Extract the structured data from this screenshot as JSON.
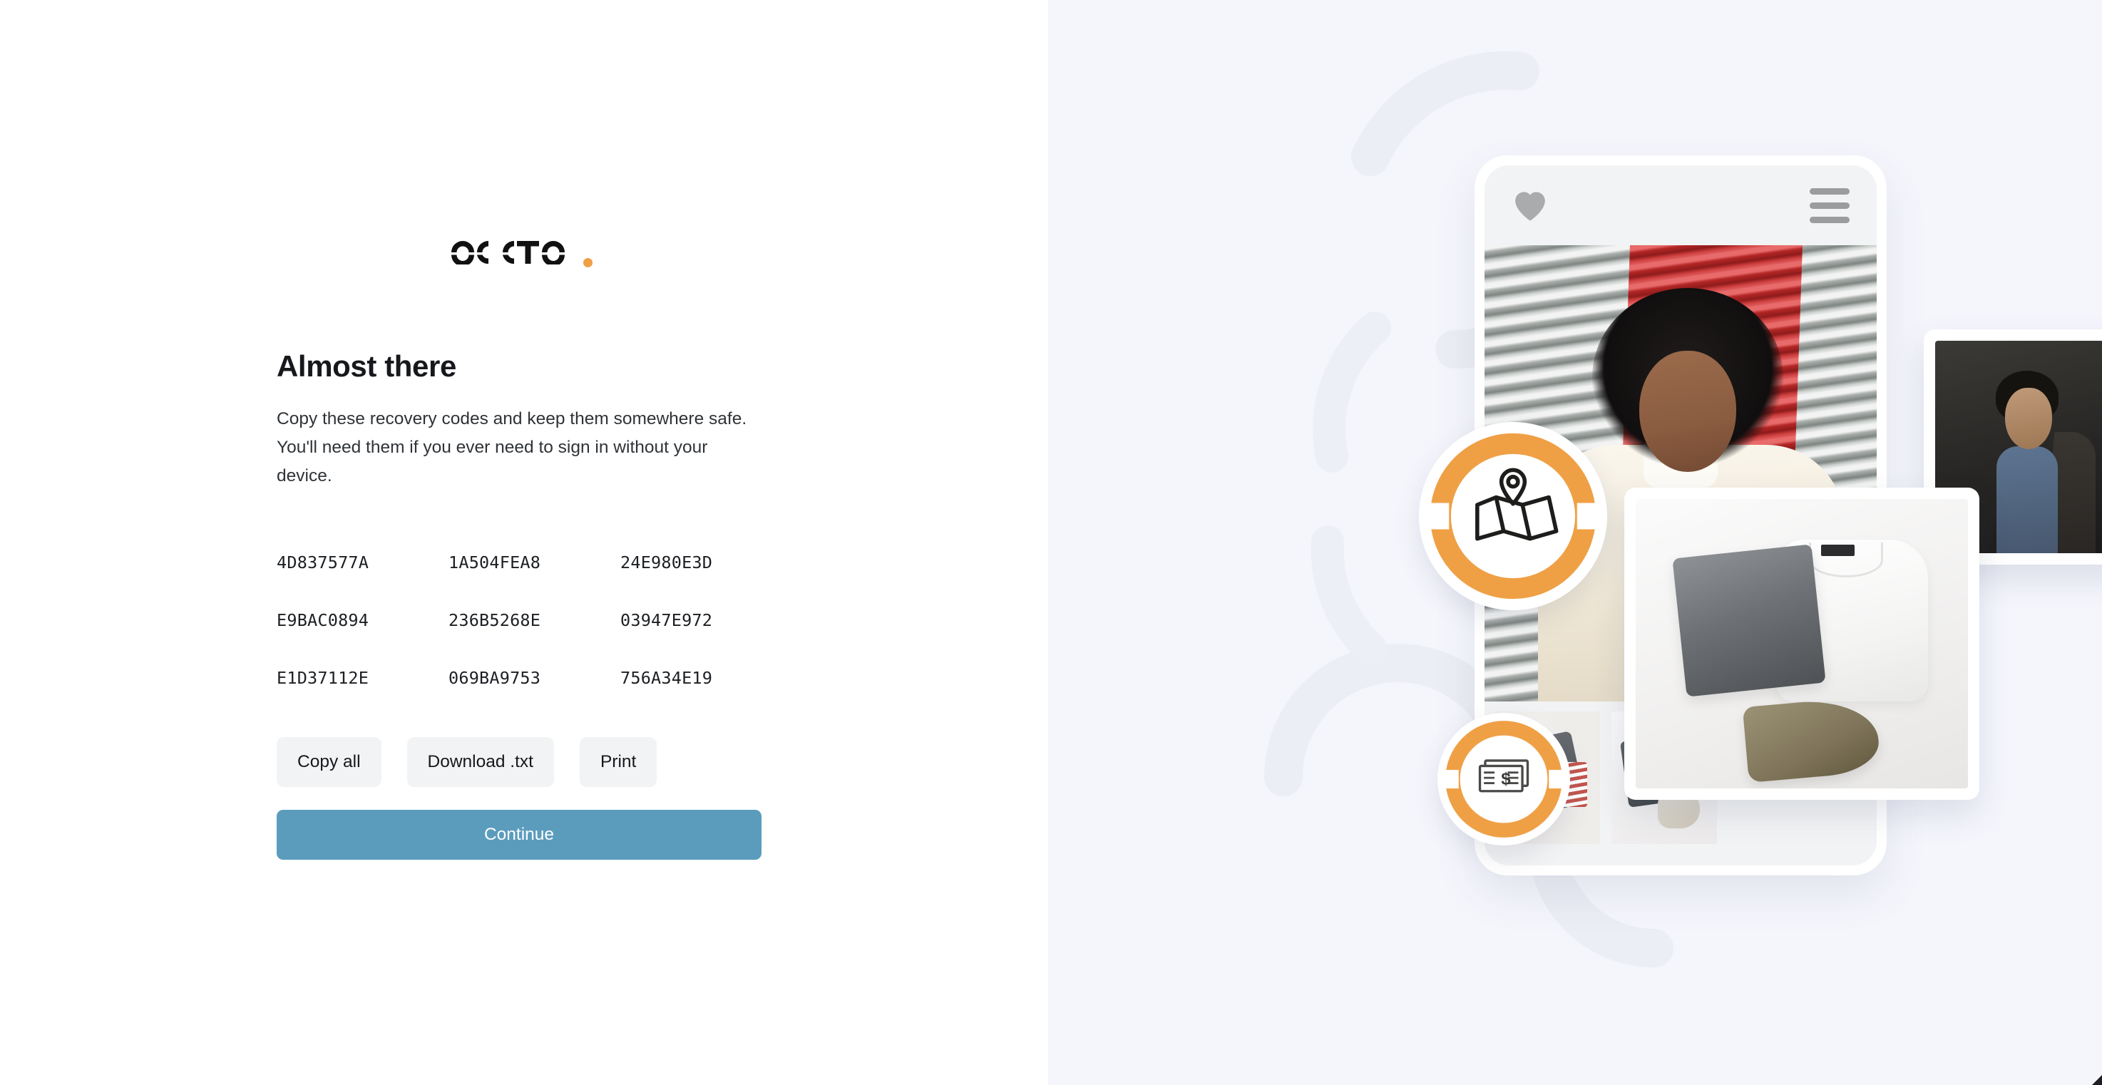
{
  "brand": {
    "logo_text": "occtoo",
    "logo_dot_color": "#EFA045",
    "accent_orange": "#EFA045",
    "primary_button_color": "#5B9CBD"
  },
  "main": {
    "heading": "Almost there",
    "description": "Copy these recovery codes and keep them somewhere safe. You'll need them if you ever need to sign in without your device."
  },
  "recovery_codes": {
    "rows": [
      [
        "4D837577A",
        "1A504FEA8",
        "24E980E3D"
      ],
      [
        "E9BAC0894",
        "236B5268E",
        "03947E972"
      ],
      [
        "E1D37112E",
        "069BA9753",
        "756A34E19"
      ]
    ]
  },
  "actions": {
    "copy_all": "Copy all",
    "download": "Download .txt",
    "print": "Print",
    "continue": "Continue"
  },
  "illustration": {
    "background_color": "#F5F6FC",
    "phone": {
      "favorite_icon": "heart-icon",
      "menu_icon": "hamburger-menu-icon"
    },
    "badges": [
      {
        "icon": "map-pin-icon",
        "ring_color": "#EFA045"
      },
      {
        "icon": "banknote-dollar-icon",
        "ring_color": "#EFA045"
      }
    ],
    "cards": [
      {
        "name": "portrait-card"
      },
      {
        "name": "flatlay-product-card"
      }
    ]
  }
}
